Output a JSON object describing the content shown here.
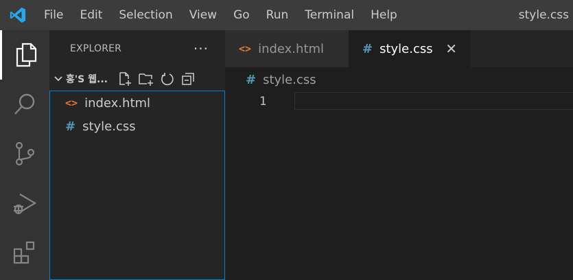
{
  "menu": [
    "File",
    "Edit",
    "Selection",
    "View",
    "Go",
    "Run",
    "Terminal",
    "Help"
  ],
  "window_title": "style.css",
  "sidebar": {
    "title": "EXPLORER",
    "more": "···",
    "folder_name": "홍'S 웹...",
    "files": [
      {
        "icon": "<>",
        "label": "index.html"
      },
      {
        "icon": "#",
        "label": "style.css"
      }
    ]
  },
  "tabs": [
    {
      "icon": "<>",
      "label": "index.html"
    },
    {
      "icon": "#",
      "label": "style.css",
      "close": "✕"
    }
  ],
  "breadcrumb": {
    "icon": "#",
    "label": "style.css"
  },
  "editor": {
    "line_number": "1"
  },
  "colors": {
    "html": "#e37933",
    "css": "#519aba",
    "vscode": "#23a9f2"
  }
}
